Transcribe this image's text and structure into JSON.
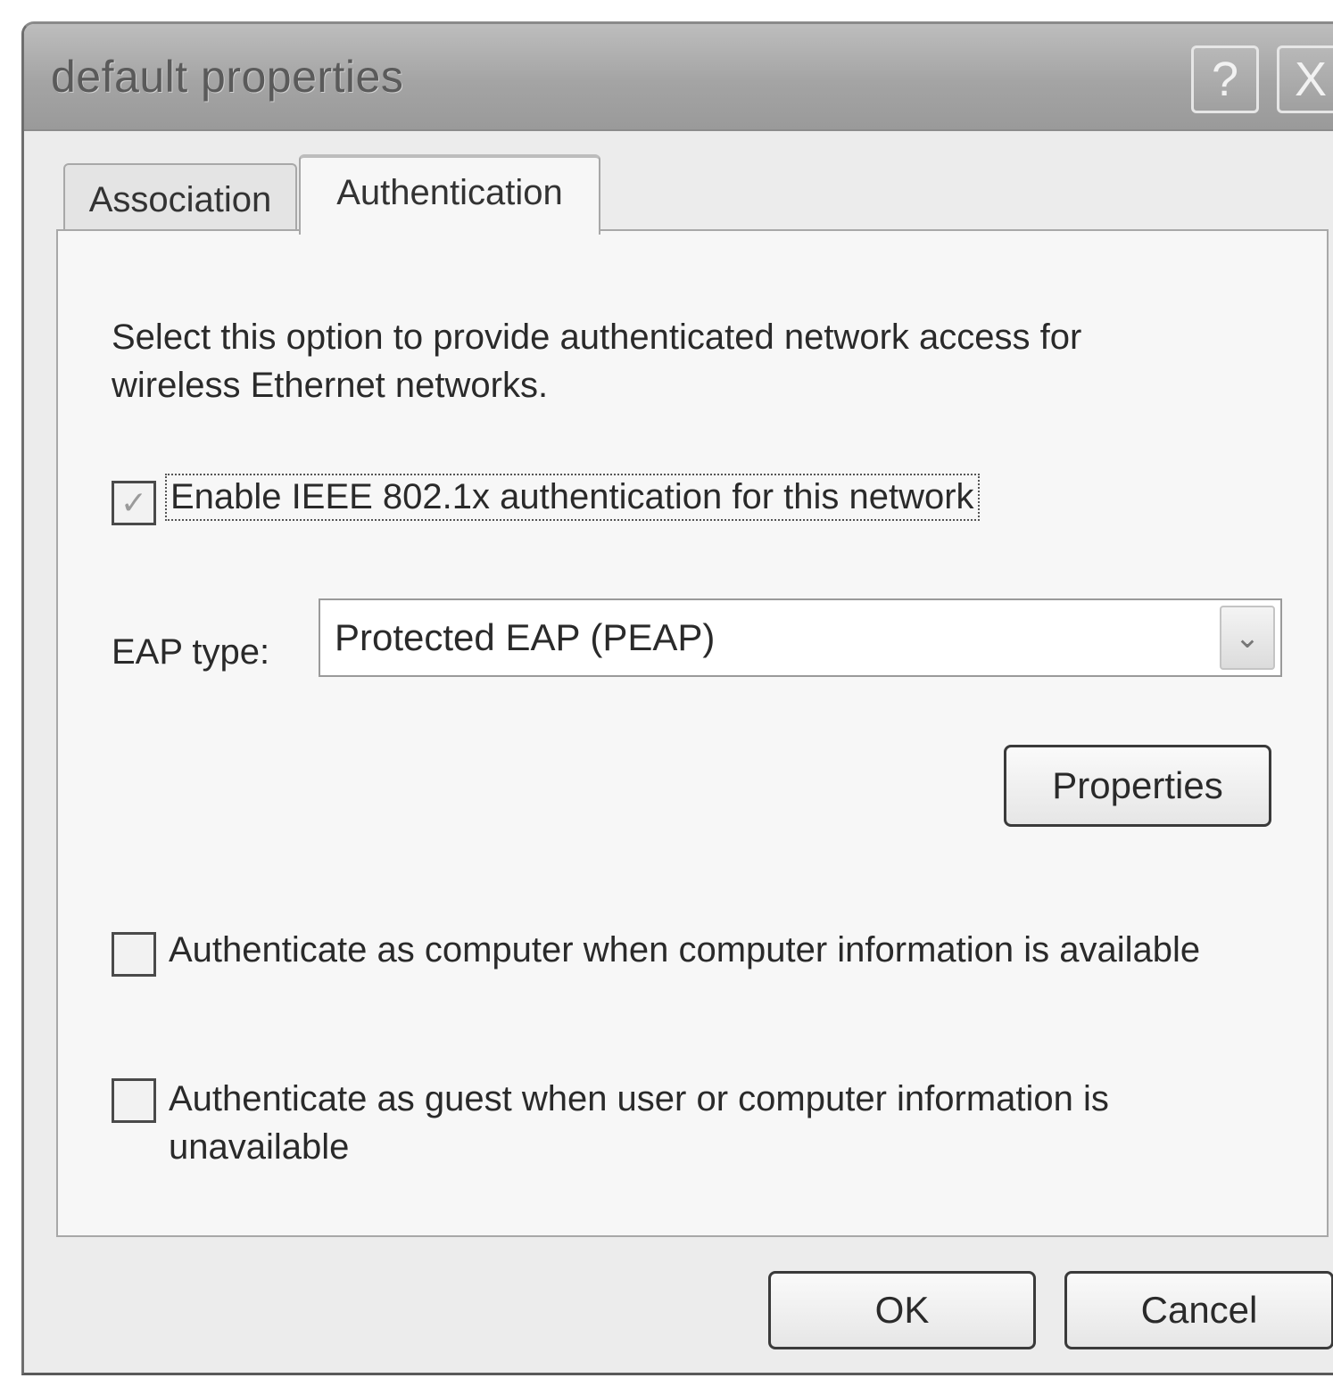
{
  "window": {
    "title": "default properties",
    "help_button": "?",
    "close_button": "X"
  },
  "tabs": [
    {
      "label": "Association",
      "selected": false
    },
    {
      "label": "Authentication",
      "selected": true
    }
  ],
  "authentication": {
    "description": "Select this option to provide authenticated network access for wireless Ethernet networks.",
    "enable_8021x": {
      "label": "Enable IEEE 802.1x authentication for this network",
      "checked": true,
      "check_glyph": "✓"
    },
    "eap_type": {
      "label": "EAP type:",
      "value": "Protected EAP (PEAP)",
      "arrow_glyph": "⌄"
    },
    "properties_button": "Properties",
    "auth_as_computer": {
      "label": "Authenticate as computer when computer information is available",
      "checked": false
    },
    "auth_as_guest": {
      "label": "Authenticate as guest when user or computer information is unavailable",
      "checked": false
    }
  },
  "footer": {
    "ok_label": "OK",
    "cancel_label": "Cancel"
  }
}
